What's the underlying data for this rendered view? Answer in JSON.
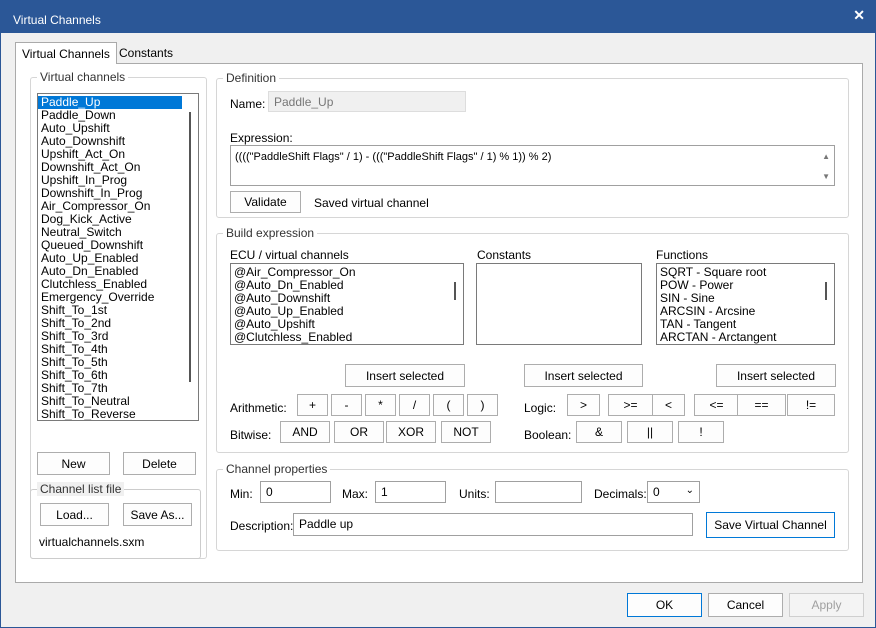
{
  "window": {
    "title": "Virtual Channels"
  },
  "tabs": [
    {
      "label": "Virtual Channels"
    },
    {
      "label": "Constants"
    }
  ],
  "virtual_channels": {
    "group_label": "Virtual channels",
    "items": [
      "Paddle_Up",
      "Paddle_Down",
      "Auto_Upshift",
      "Auto_Downshift",
      "Upshift_Act_On",
      "Downshift_Act_On",
      "Upshift_In_Prog",
      "Downshift_In_Prog",
      "Air_Compressor_On",
      "Dog_Kick_Active",
      "Neutral_Switch",
      "Queued_Downshift",
      "Auto_Up_Enabled",
      "Auto_Dn_Enabled",
      "Clutchless_Enabled",
      "Emergency_Override",
      "Shift_To_1st",
      "Shift_To_2nd",
      "Shift_To_3rd",
      "Shift_To_4th",
      "Shift_To_5th",
      "Shift_To_6th",
      "Shift_To_7th",
      "Shift_To_Neutral",
      "Shift_To_Reverse"
    ],
    "new_label": "New",
    "delete_label": "Delete"
  },
  "channel_list_file": {
    "group_label": "Channel list file",
    "load_label": "Load...",
    "save_as_label": "Save As...",
    "filename": "virtualchannels.sxm"
  },
  "definition": {
    "group_label": "Definition",
    "name_label": "Name:",
    "name_value": "Paddle_Up",
    "expression_label": "Expression:",
    "expression_value": "((((\"PaddleShift Flags\" / 1) - (((\"PaddleShift Flags\" / 1) % 1)) % 2)",
    "validate_label": "Validate",
    "status": "Saved virtual channel"
  },
  "build_expression": {
    "group_label": "Build expression",
    "ecu_label": "ECU / virtual channels",
    "ecu_items": [
      "@Air_Compressor_On",
      "@Auto_Dn_Enabled",
      "@Auto_Downshift",
      "@Auto_Up_Enabled",
      "@Auto_Upshift",
      "@Clutchless_Enabled"
    ],
    "constants_label": "Constants",
    "functions_label": "Functions",
    "function_items": [
      "SQRT  -  Square root",
      "POW  -  Power",
      "SIN  -  Sine",
      "ARCSIN  -  Arcsine",
      "TAN  -  Tangent",
      "ARCTAN  -  Arctangent"
    ],
    "insert_label": "Insert selected",
    "arithmetic_label": "Arithmetic:",
    "arithmetic_ops": [
      "+",
      "-",
      "*",
      "/",
      "(",
      ")"
    ],
    "logic_label": "Logic:",
    "logic_ops": [
      ">",
      ">=",
      "<",
      "<=",
      "==",
      "!="
    ],
    "bitwise_label": "Bitwise:",
    "bitwise_ops": [
      "AND",
      "OR",
      "XOR",
      "NOT"
    ],
    "boolean_label": "Boolean:",
    "boolean_ops": [
      "&",
      "||",
      "!"
    ]
  },
  "channel_properties": {
    "group_label": "Channel properties",
    "min_label": "Min:",
    "min_value": "0",
    "max_label": "Max:",
    "max_value": "1",
    "units_label": "Units:",
    "units_value": "",
    "decimals_label": "Decimals:",
    "decimals_value": "0",
    "description_label": "Description:",
    "description_value": "Paddle up",
    "save_label": "Save Virtual Channel"
  },
  "footer": {
    "ok_label": "OK",
    "cancel_label": "Cancel",
    "apply_label": "Apply"
  },
  "colors": {
    "titlebar": "#2b5797",
    "selection": "#0078d7"
  }
}
